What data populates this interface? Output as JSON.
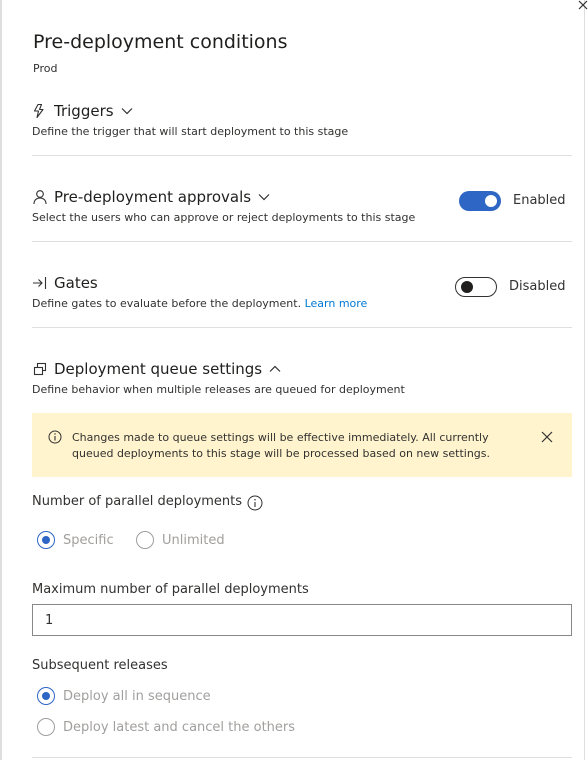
{
  "panel": {
    "title": "Pre-deployment conditions",
    "stage_name": "Prod"
  },
  "triggers": {
    "label": "Triggers",
    "description": "Define the trigger that will start deployment to this stage"
  },
  "approvals": {
    "label": "Pre-deployment approvals",
    "description": "Select the users who can approve or reject deployments to this stage",
    "toggle_state": "Enabled"
  },
  "gates": {
    "label": "Gates",
    "description": "Define gates to evaluate before the deployment.",
    "link_text": "Learn more",
    "toggle_state": "Disabled"
  },
  "queue": {
    "label": "Deployment queue settings",
    "description": "Define behavior when multiple releases are queued for deployment",
    "banner_message": "Changes made to queue settings will be effective immediately. All currently queued deployments to this stage will be processed based on new settings.",
    "parallel_label": "Number of parallel deployments",
    "parallel_options": [
      "Specific",
      "Unlimited"
    ],
    "parallel_selected": "Specific",
    "max_label": "Maximum number of parallel deployments",
    "max_value": "1",
    "subsequent_label": "Subsequent releases",
    "subsequent_options": [
      "Deploy all in sequence",
      "Deploy latest and cancel the others"
    ],
    "subsequent_selected": "Deploy all in sequence"
  },
  "colors": {
    "accent": "#2d66c4",
    "link": "#0078d4",
    "banner_bg": "#fff4ce",
    "disabled_text": "#a19f9d"
  }
}
